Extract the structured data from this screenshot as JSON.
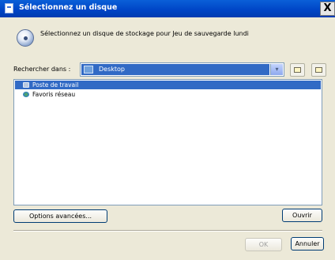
{
  "window": {
    "title": "Sélectionnez un disque",
    "close_glyph": "X"
  },
  "header": {
    "icon": "disk-icon",
    "text": "Sélectionnez un disque de stockage pour Jeu de sauvegarde lundi"
  },
  "search": {
    "label": "Rechercher dans :",
    "selected": "Desktop",
    "selected_icon": "desktop-icon",
    "dropdown_glyph": "▾",
    "toolbar": [
      {
        "name": "up-folder",
        "icon": "up-folder-icon"
      },
      {
        "name": "new-folder",
        "icon": "new-folder-icon"
      }
    ]
  },
  "file_list": {
    "items": [
      {
        "label": "Poste de travail",
        "icon": "computer-icon",
        "selected": true
      },
      {
        "label": "Favoris réseau",
        "icon": "network-icon",
        "selected": false
      }
    ]
  },
  "buttons": {
    "advanced": "Options avancées...",
    "open": "Ouvrir",
    "ok": "OK",
    "cancel": "Annuler"
  },
  "colors": {
    "titlebar": "#0046c7",
    "selection": "#316ac5",
    "face": "#ece9d8"
  }
}
